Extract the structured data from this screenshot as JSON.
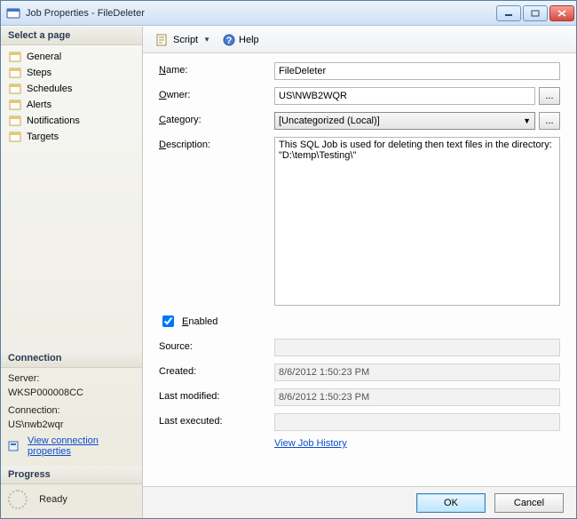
{
  "window": {
    "title": "Job Properties - FileDeleter"
  },
  "toolbar": {
    "script": "Script",
    "help": "Help"
  },
  "left": {
    "selectPage": "Select a page",
    "pages": [
      "General",
      "Steps",
      "Schedules",
      "Alerts",
      "Notifications",
      "Targets"
    ],
    "connectionHeader": "Connection",
    "serverLabel": "Server:",
    "serverValue": "WKSP000008CC",
    "connLabel": "Connection:",
    "connValue": "US\\nwb2wqr",
    "viewConn": "View connection properties",
    "progressHeader": "Progress",
    "progressStatus": "Ready"
  },
  "form": {
    "labels": {
      "name": "Name:",
      "owner": "Owner:",
      "category": "Category:",
      "description": "Description:",
      "enabled": "Enabled",
      "source": "Source:",
      "created": "Created:",
      "lastModified": "Last modified:",
      "lastExecuted": "Last executed:"
    },
    "underlineCue": {
      "name": "N",
      "owner": "O",
      "category": "C",
      "description": "D",
      "enabled": "E"
    },
    "name": "FileDeleter",
    "owner": "US\\NWB2WQR",
    "category": "[Uncategorized (Local)]",
    "description": "This SQL Job is used for deleting then text files in the directory:\n\"D:\\temp\\Testing\\\"\n",
    "enabled": true,
    "source": "",
    "created": "8/6/2012 1:50:23 PM",
    "lastModified": "8/6/2012 1:50:23 PM",
    "lastExecuted": "",
    "viewHistory": "View Job History",
    "ellipsis": "..."
  },
  "footer": {
    "ok": "OK",
    "cancel": "Cancel"
  }
}
